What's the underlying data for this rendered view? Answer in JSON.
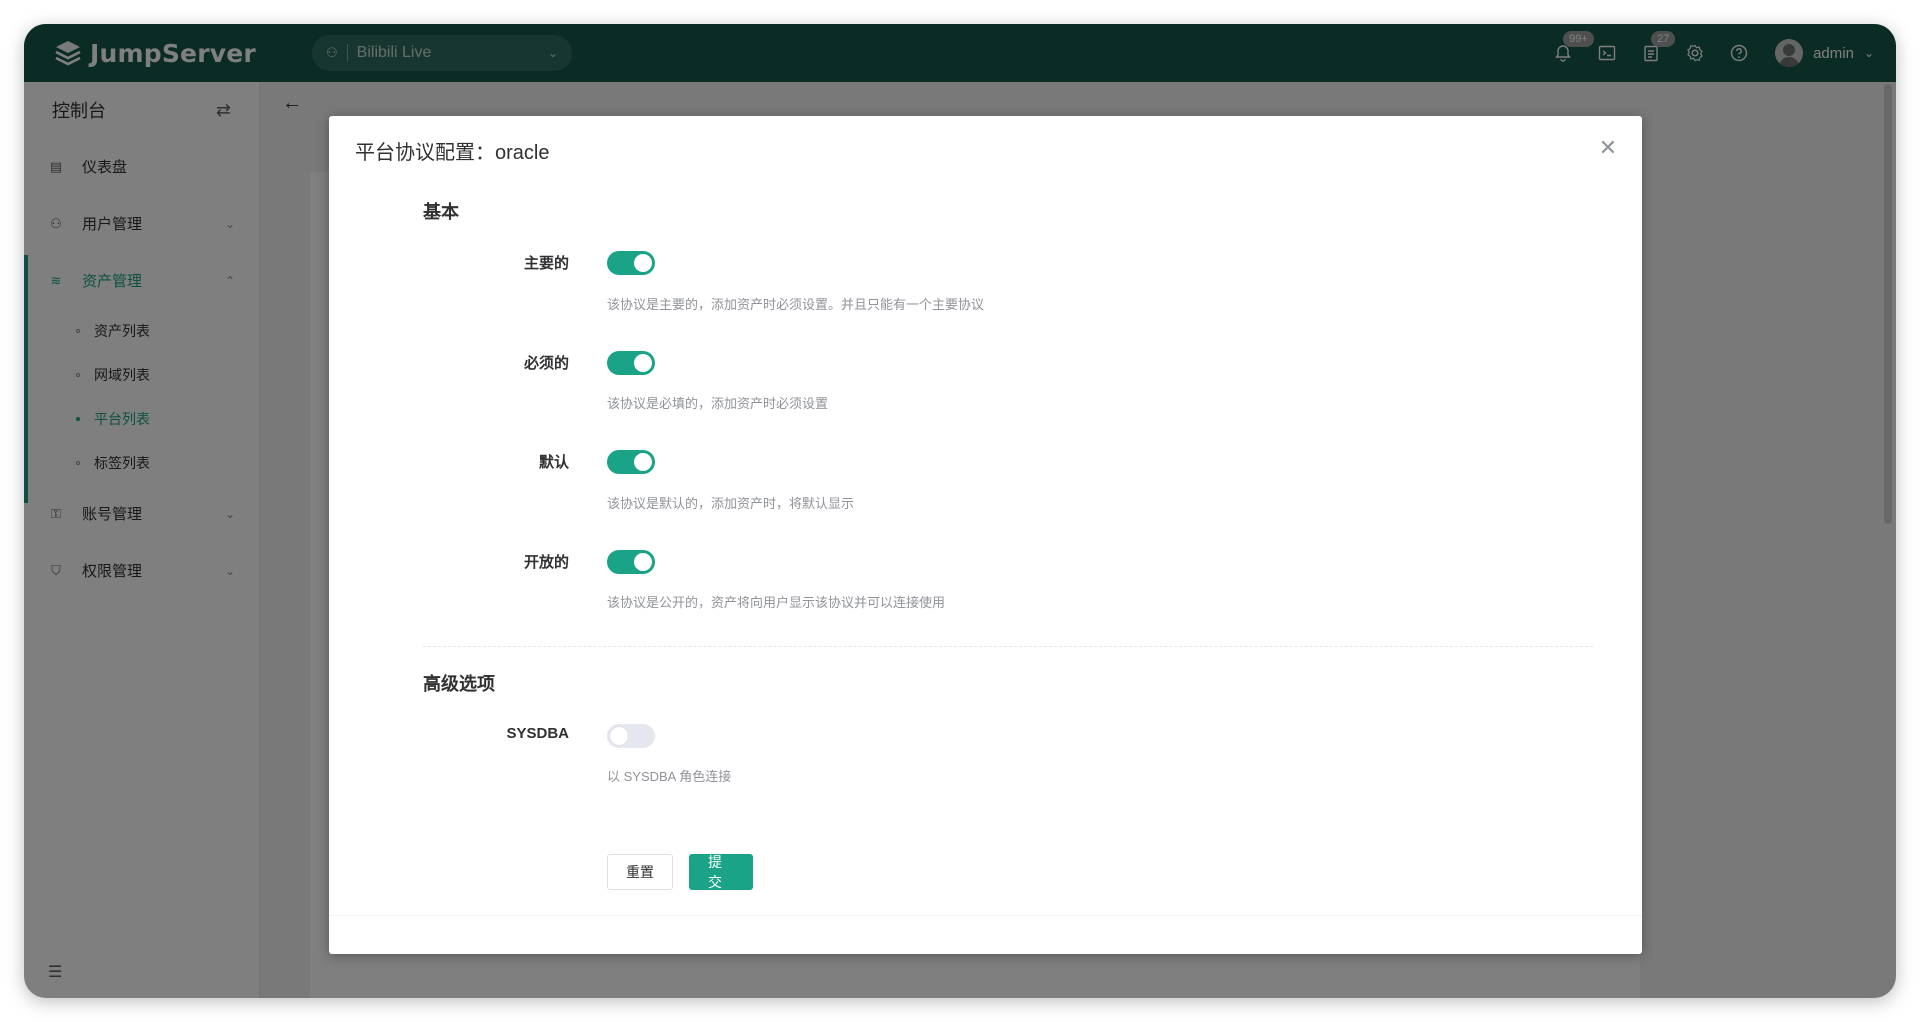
{
  "app": {
    "logo_text": "JumpServer"
  },
  "org_selector": {
    "value": "Bilibili Live"
  },
  "header": {
    "notifications_badge": "99+",
    "tasks_badge": "27",
    "user_name": "admin"
  },
  "sidebar": {
    "title": "控制台",
    "items": [
      {
        "label": "仪表盘"
      },
      {
        "label": "用户管理"
      },
      {
        "label": "资产管理"
      },
      {
        "label": "账号管理"
      },
      {
        "label": "权限管理"
      }
    ],
    "subitems": [
      {
        "label": "资产列表"
      },
      {
        "label": "网域列表"
      },
      {
        "label": "平台列表"
      },
      {
        "label": "标签列表"
      }
    ]
  },
  "dialog": {
    "title": "平台协议配置：oracle",
    "basic": {
      "title": "基本",
      "rows": [
        {
          "label": "主要的",
          "on": true,
          "hint": "该协议是主要的，添加资产时必须设置。并且只能有一个主要协议"
        },
        {
          "label": "必须的",
          "on": true,
          "hint": "该协议是必填的，添加资产时必须设置"
        },
        {
          "label": "默认",
          "on": true,
          "hint": "该协议是默认的，添加资产时，将默认显示"
        },
        {
          "label": "开放的",
          "on": true,
          "hint": "该协议是公开的，资产将向用户显示该协议并可以连接使用"
        }
      ]
    },
    "advanced": {
      "title": "高级选项",
      "rows": [
        {
          "label": "SYSDBA",
          "on": false,
          "hint": "以 SYSDBA 角色连接"
        }
      ]
    },
    "buttons": {
      "reset": "重置",
      "submit": "提交"
    }
  },
  "colors": {
    "topbar": "#15594b",
    "accent": "#1aa386"
  }
}
